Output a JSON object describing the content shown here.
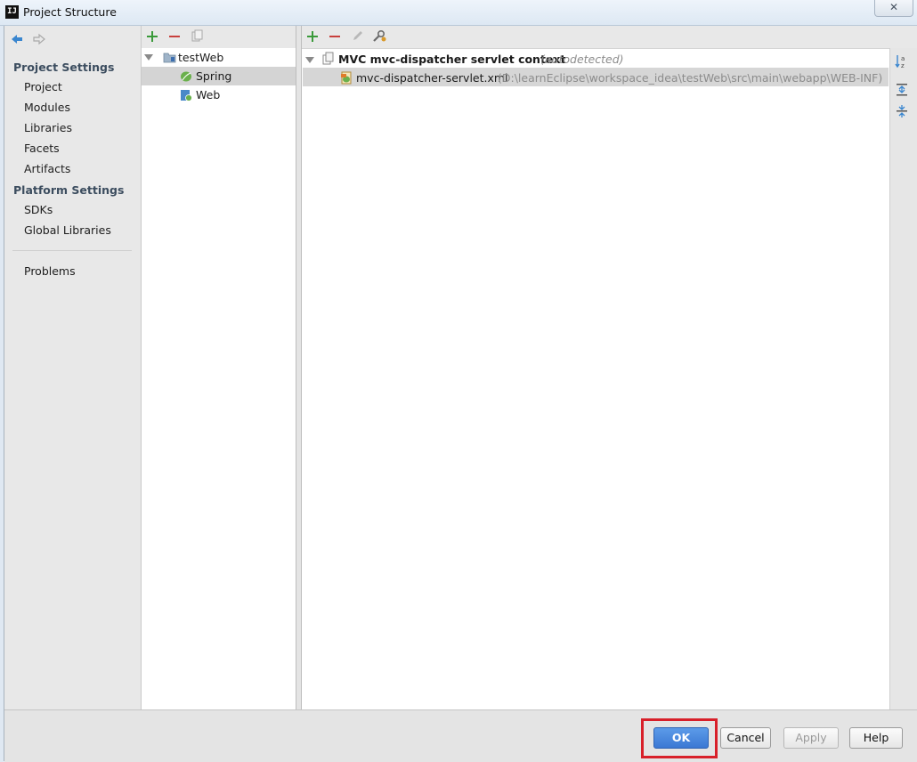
{
  "window": {
    "title": "Project Structure",
    "close_glyph": "✕",
    "app_icon_text": "IJ"
  },
  "nav": {
    "project_settings_header": "Project Settings",
    "project_settings_items": [
      "Project",
      "Modules",
      "Libraries",
      "Facets",
      "Artifacts"
    ],
    "platform_settings_header": "Platform Settings",
    "platform_settings_items": [
      "SDKs",
      "Global Libraries"
    ],
    "problems": "Problems"
  },
  "tree": {
    "root": "testWeb",
    "children": [
      "Spring",
      "Web"
    ],
    "selected": "Spring"
  },
  "content": {
    "context_title": "MVC mvc-dispatcher servlet context",
    "context_note": "(autodetected)",
    "file_name": "mvc-dispatcher-servlet.xml",
    "file_path": "(D:\\learnEclipse\\workspace_idea\\testWeb\\src\\main\\webapp\\WEB-INF)"
  },
  "buttons": {
    "ok": "OK",
    "cancel": "Cancel",
    "apply": "Apply",
    "help": "Help"
  },
  "colors": {
    "accent": "#3b78d4",
    "highlight": "#d8202a",
    "add": "#3a9a3a",
    "remove": "#c8403c"
  },
  "icons": [
    "back-arrow-icon",
    "forward-arrow-icon",
    "add-icon",
    "remove-icon",
    "copy-icon",
    "edit-icon",
    "wrench-icon",
    "sort-az-icon",
    "expand-all-icon",
    "collapse-all-icon",
    "folder-icon",
    "spring-leaf-icon",
    "web-icon",
    "xml-file-icon",
    "context-icon"
  ]
}
